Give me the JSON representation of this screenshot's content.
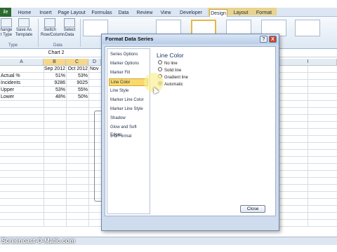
{
  "ribbon": {
    "tabs": [
      "ile",
      "Home",
      "Insert",
      "Page Layout",
      "Formulas",
      "Data",
      "Review",
      "View",
      "Developer",
      "Design",
      "Layout",
      "Format"
    ],
    "active_tab": "Design",
    "buttons": {
      "change_type": "hange\nt Type",
      "save_template": "Save As\nTemplate",
      "switch_row_col": "Switch\nRow/Column",
      "select_data": "Select\nData"
    },
    "groups": {
      "type": "Type",
      "data": "Data"
    }
  },
  "name_box": "Chart 2",
  "sheet": {
    "columns": [
      "A",
      "B",
      "C",
      "D",
      "I"
    ],
    "header_row": [
      "",
      "Sep 2012",
      "Oct 2012",
      "Nov"
    ],
    "rows": [
      {
        "label": "Actual %",
        "values": [
          "51%",
          "53%"
        ]
      },
      {
        "label": "Incidents",
        "values": [
          "9286",
          "9025"
        ]
      },
      {
        "label": "Upper",
        "values": [
          "53%",
          "55%"
        ]
      },
      {
        "label": "Lower",
        "values": [
          "48%",
          "50%"
        ]
      }
    ]
  },
  "dialog": {
    "title": "Format Data Series",
    "help_label": "?",
    "close_x": "X",
    "nav_items": [
      "Series Options",
      "Marker Options",
      "Marker Fill",
      "Line Color",
      "Line Style",
      "Marker Line Color",
      "Marker Line Style",
      "Shadow",
      "Glow and Soft Edges",
      "3-D Format"
    ],
    "selected_nav": "Line Color",
    "panel_title": "Line Color",
    "options": [
      "No line",
      "Solid line",
      "Gradient line",
      "Automatic"
    ],
    "selected_option": "Automatic",
    "close_button": "Close"
  },
  "watermark": "Screencast-O-Matic.com"
}
